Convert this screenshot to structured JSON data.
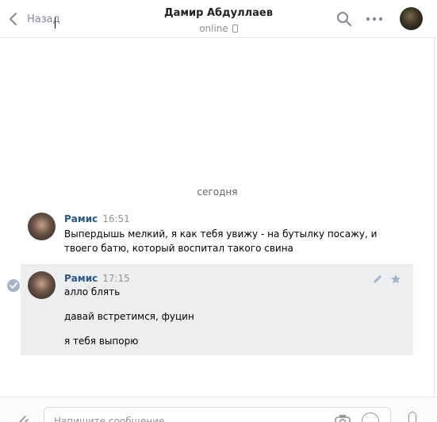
{
  "header": {
    "back_label": "Назад",
    "title": "Дамир Абдуллаев",
    "status": "online",
    "icons": [
      "chevron-left-icon",
      "search-icon",
      "more-icon",
      "phone-icon"
    ]
  },
  "date_separator": "сегодня",
  "messages": [
    {
      "author": "Рамис",
      "time": "16:51",
      "lines": [
        "Выпердышь мелкий, я как тебя увижу - на бутылку посажу, и",
        "твоего батю, который воспитал такого свина"
      ]
    },
    {
      "author": "Рамис",
      "time": "17:15",
      "lines": [
        "алло блять",
        "давай встретимся, фуцин",
        "я тебя выпорю"
      ]
    }
  ],
  "composer": {
    "placeholder": "Напишите сообщение"
  },
  "colors": {
    "accent": "#2a5885",
    "muted": "#939393",
    "selected_bg": "#edeef0",
    "check": "#a5b3c7"
  }
}
